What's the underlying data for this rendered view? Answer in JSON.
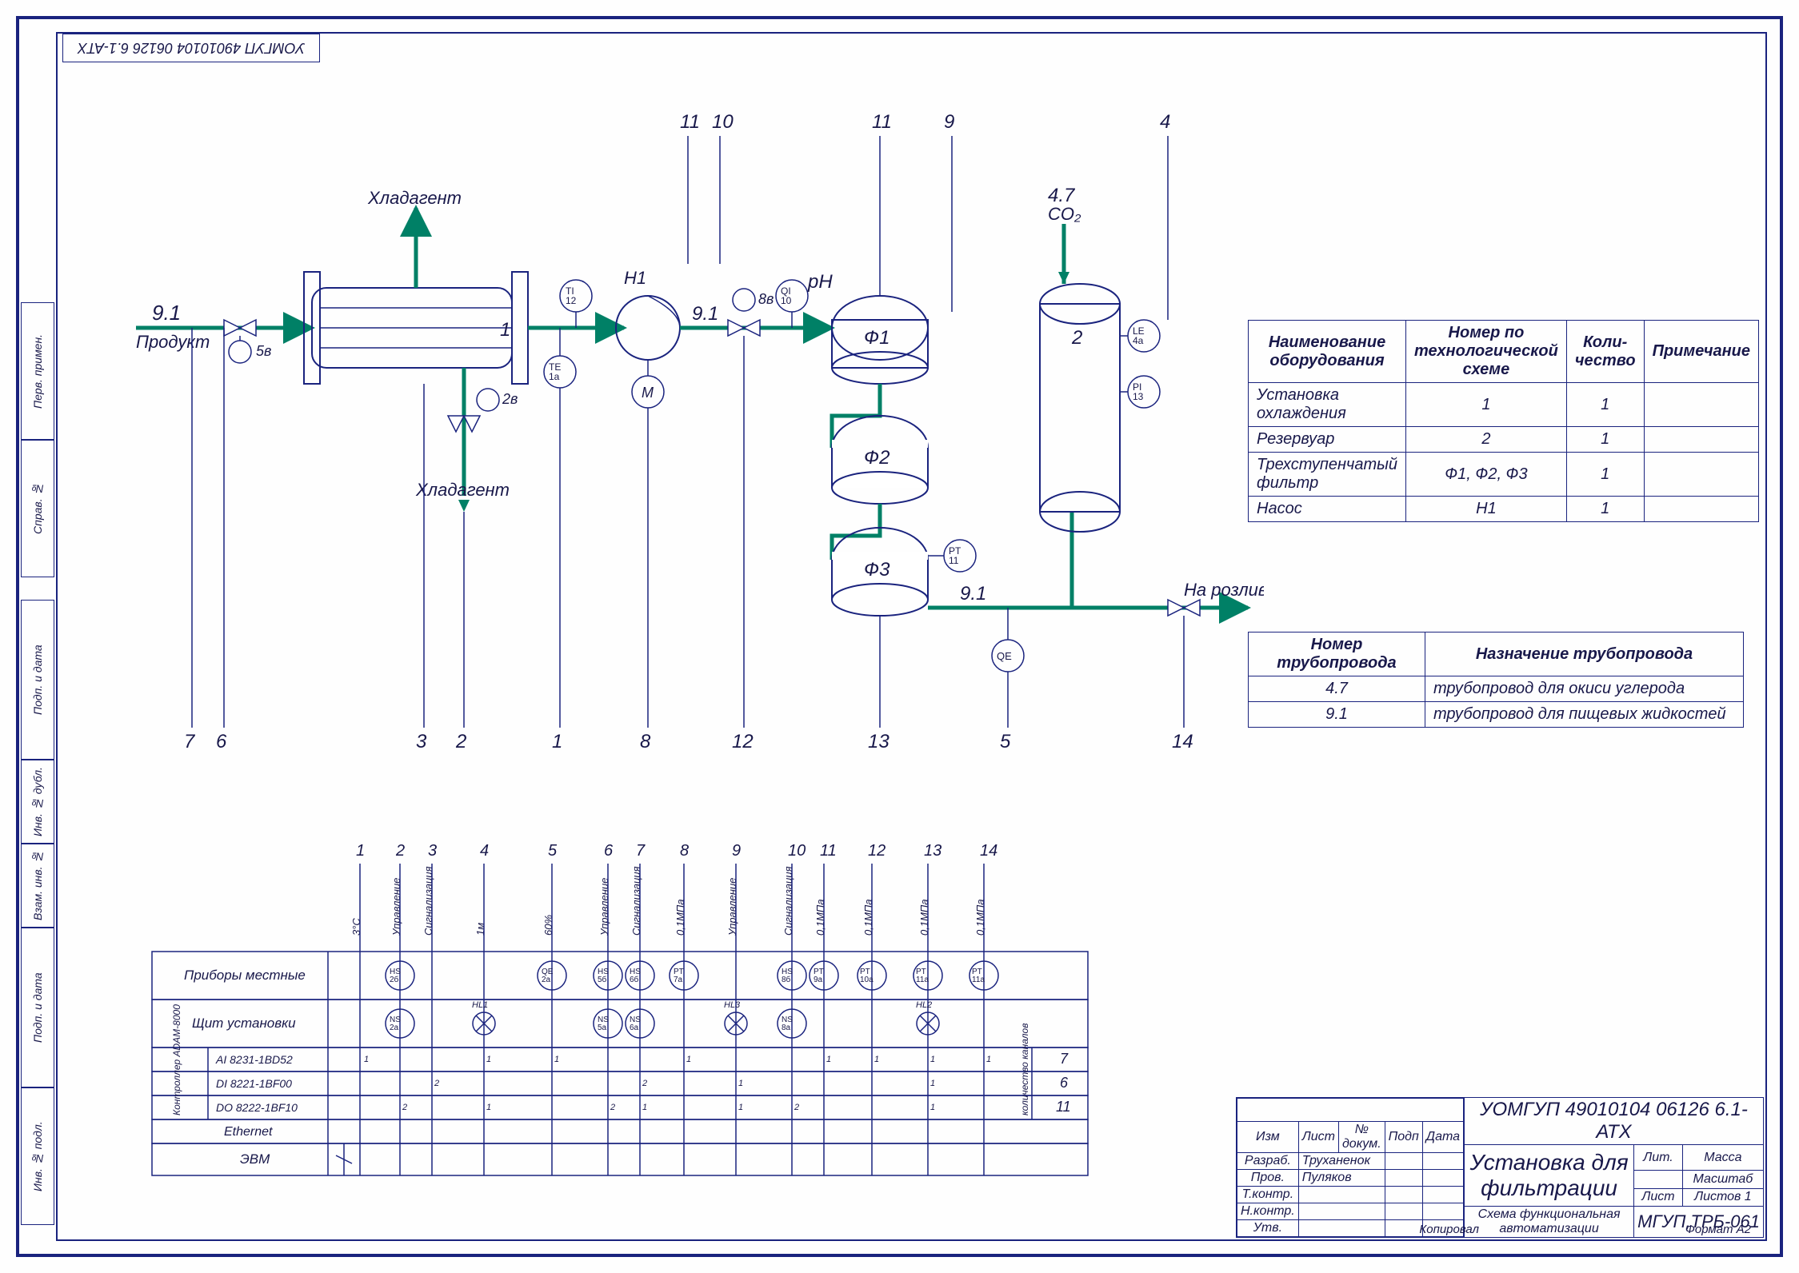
{
  "drawing_code_top": "УОМГУП 49010104 06126 6.1-АТХ",
  "pid": {
    "product_label": "Продукт",
    "hlad_top": "Хладагент",
    "hlad_bot": "Хладагент",
    "pipe_9_1": "9.1",
    "pipe_4_7": "4.7",
    "co2": "CO₂",
    "ph": "pH",
    "pump": {
      "tag": "H1",
      "motor": "M"
    },
    "cooler_tag": "1",
    "tank_tag": "2",
    "filters": {
      "f1": "Ф1",
      "f2": "Ф2",
      "f3": "Ф3"
    },
    "instruments": {
      "ti12": "TI\n12",
      "te1a": "TE\n1а",
      "qi10": "QI\n10",
      "le4a": "LE\n4а",
      "pi13": "PI\n13",
      "pt11": "PT\n11",
      "qe": "QE"
    },
    "valve_labels": {
      "v5": "5в",
      "v2": "2в",
      "v8": "8в"
    },
    "outlet": "На розлив",
    "bottom_nums": [
      "7",
      "6",
      "3",
      "2",
      "1",
      "8",
      "12",
      "13",
      "5",
      "14"
    ],
    "top_nums": [
      "11",
      "10",
      "11",
      "9",
      "4"
    ]
  },
  "equip_table": {
    "headers": [
      "Наименование оборудования",
      "Номер по технологической схеме",
      "Коли-чество",
      "Примечание"
    ],
    "rows": [
      [
        "Установка охлаждения",
        "1",
        "1",
        ""
      ],
      [
        "Резервуар",
        "2",
        "1",
        ""
      ],
      [
        "Трехступенчатый фильтр",
        "Ф1, Ф2, Ф3",
        "1",
        ""
      ],
      [
        "Насос",
        "Н1",
        "1",
        ""
      ]
    ]
  },
  "pipe_table": {
    "headers": [
      "Номер трубопровода",
      "Назначение трубопровода"
    ],
    "rows": [
      [
        "4.7",
        "трубопровод для окиси углерода"
      ],
      [
        "9.1",
        "трубопровод для пищевых жидкостей"
      ]
    ]
  },
  "control_table": {
    "top_nums": [
      "1",
      "2",
      "3",
      "4",
      "5",
      "6",
      "7",
      "8",
      "9",
      "10",
      "11",
      "12",
      "13",
      "14"
    ],
    "top_labels": [
      "3°C",
      "Управление",
      "Сигнализация",
      "1м",
      "60%",
      "Управление",
      "Сигнализация",
      "0,1МПа",
      "Управление",
      "Сигнализация",
      "0,1МПа",
      "0,1МПа",
      "0,1МПа"
    ],
    "row_labels": [
      "Приборы местные",
      "Щит установки",
      "AI 8231-1BD52",
      "DI 8221-1BF00",
      "DO 8222-1BF10",
      "Ethernet",
      "ЭВМ"
    ],
    "side_label": "Контроллер\nADAM-8000",
    "channels_label": "количество каналов",
    "channels": [
      "7",
      "6",
      "11"
    ],
    "bubbles_r1": [
      "HS\n2б",
      "QE\n2а",
      "HS\n5б",
      "HS\n6б",
      "PT\n7а",
      "HS\n8б",
      "PT\n9а",
      "PT\n10а",
      "PT\n11а",
      "PT\n11а"
    ],
    "bubbles_r2": [
      "NS\n2а",
      "HL1",
      "NS\n5а",
      "NS\n6а",
      "HL3",
      "NS\n8а",
      "HL2"
    ]
  },
  "titleblock": {
    "code": "УОМГУП 49010104 06126 6.1-АТХ",
    "title1": "Установка для",
    "title2": "фильтрации",
    "subtitle": "Схема функциональная автоматизации",
    "group": "МГУП,ТРБ-061",
    "rows_left": [
      "Изм",
      "Лист",
      "№ докум.",
      "Подп",
      "Дата"
    ],
    "roles": [
      [
        "Разраб.",
        "Труханенок"
      ],
      [
        "Пров.",
        "Пуляков"
      ],
      [
        "Т.контр.",
        ""
      ],
      [
        "Н.контр.",
        ""
      ],
      [
        "Утв.",
        ""
      ]
    ],
    "cols_right": [
      "Лит.",
      "Масса",
      "Масштаб"
    ],
    "sheet": "Лист",
    "sheets": "Листов   1",
    "format": "Формат  A2",
    "kopir": "Копировал"
  },
  "side_labels": [
    "Инв. № подл.",
    "Подп. и дата",
    "Взам. инв. №",
    "Инв. № дубл.",
    "Подп. и дата",
    "Справ. №",
    "Перв. примен."
  ]
}
